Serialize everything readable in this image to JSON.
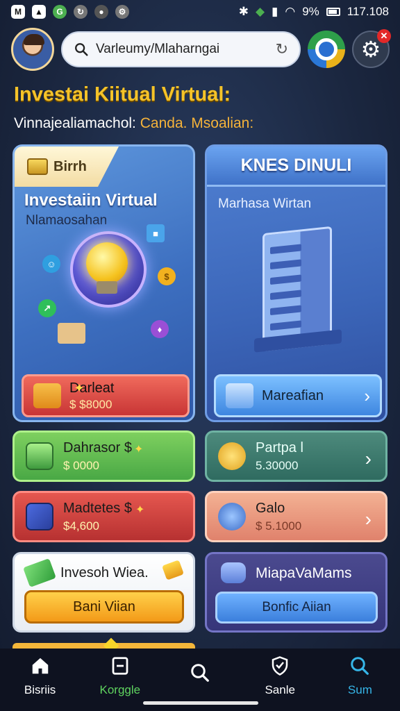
{
  "status_bar": {
    "time": "117.108",
    "battery": "9%"
  },
  "header": {
    "search_value": "Varleumy/Mlaharngai",
    "settings_badge": "✕"
  },
  "page": {
    "title": "Investai Kiitual Virtual:",
    "subtitle_prefix": "Vinnajealiamachol:",
    "subtitle_highlight": "Canda. Msoalian:"
  },
  "card_left": {
    "tag": "Birrh",
    "heading": "Investaiin Virtual",
    "sub": "Nlamaosahan",
    "action_label": "Darleat",
    "action_value": "$ $8000"
  },
  "card_right": {
    "banner": "KNES DINULI",
    "sub": "Marhasa Wirtan",
    "action_label": "Mareafian"
  },
  "tiles": [
    {
      "label": "Dahrasor $",
      "value": "$ 0000"
    },
    {
      "label": "Partpa l",
      "value": "5.30000"
    },
    {
      "label": "Madtetes $",
      "value": "$4,600"
    },
    {
      "label": "Galo",
      "value": "$ 5.1000"
    }
  ],
  "promo_left": {
    "title": "Invesoh Wiea.",
    "button": "Bani Viian"
  },
  "promo_right": {
    "title": "MiapaVaMams",
    "button": "Bonfic Aiian"
  },
  "nav": [
    {
      "label": "Bisriis",
      "icon": "home-icon"
    },
    {
      "label": "Korggle",
      "icon": "card-icon"
    },
    {
      "label": "",
      "icon": "search-icon"
    },
    {
      "label": "Sanle",
      "icon": "shield-icon"
    },
    {
      "label": "Sum",
      "icon": "search-icon"
    }
  ],
  "colors": {
    "title": "#f5c329",
    "accent_orange": "#f39a18",
    "nav_active_green": "#5fd35f",
    "nav_active_cyan": "#36b6e8"
  }
}
